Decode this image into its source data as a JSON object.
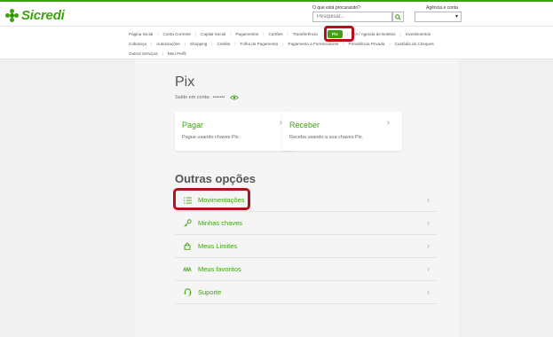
{
  "header": {
    "brand": "Sicredi",
    "search_label": "O que está procurando?",
    "search_placeholder": "Pesquisar...",
    "agency_label": "Agência e conta",
    "agency_value": "▾"
  },
  "nav": {
    "row1": [
      "Página Inicial",
      "Conta Corrente",
      "Capital Social",
      "Pagamentos",
      "Cartões",
      "Transferência",
      "Pix",
      "DA / Agenda de Boletos",
      "Investimentos"
    ],
    "row2": [
      "Cobrança",
      "Autorizações",
      "Shopping",
      "Crédito",
      "Folha de Pagamento",
      "Pagamento a Fornecedores",
      "Previdência Privada",
      "Custódia de Cheques"
    ],
    "row3": [
      "Outros Serviços",
      "Meu Perfil"
    ],
    "active": "Pix"
  },
  "main": {
    "title": "Pix",
    "balance_label": "Saldo em conta:",
    "balance_value": "•••••••",
    "cards": [
      {
        "title": "Pagar",
        "desc": "Pague usando chaves Pix."
      },
      {
        "title": "Receber",
        "desc": "Receba usando a sua chaves Pix."
      }
    ],
    "section_title": "Outras opções",
    "options": [
      {
        "label": "Movimentações",
        "icon": "list-icon"
      },
      {
        "label": "Minhas chaves",
        "icon": "key-icon"
      },
      {
        "label": "Meus Limites",
        "icon": "lock-icon"
      },
      {
        "label": "Meus favoritos",
        "icon": "favorites-icon"
      },
      {
        "label": "Suporte",
        "icon": "support-icon"
      }
    ]
  },
  "colors": {
    "brand_green": "#3fa110",
    "highlight_red": "#b3111b"
  }
}
